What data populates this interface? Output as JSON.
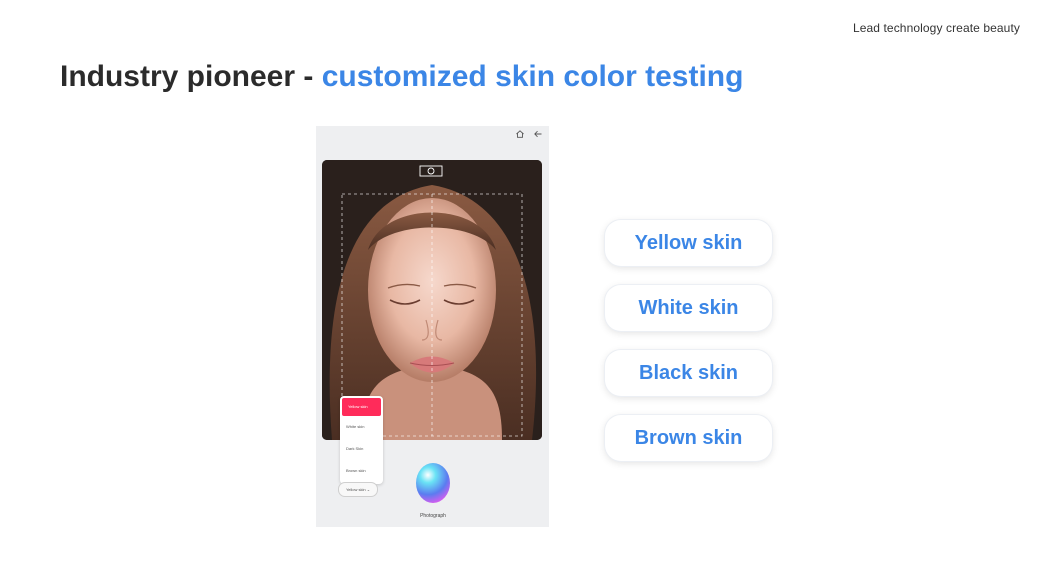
{
  "header": {
    "tagline": "Lead technology create beauty",
    "title_prefix": "Industry pioneer - ",
    "title_accent": "customized skin color testing"
  },
  "device": {
    "icons": [
      "home-icon",
      "back-arrow-icon"
    ],
    "skin_menu": [
      "Yellow skin",
      "White skin",
      "Dark Skin",
      "Brown skin"
    ],
    "selected_skin": "Yellow skin",
    "capture_label": "Photograph"
  },
  "options": [
    {
      "label": "Yellow skin"
    },
    {
      "label": "White skin"
    },
    {
      "label": "Black skin"
    },
    {
      "label": "Brown skin"
    }
  ],
  "colors": {
    "accent": "#3b86e6",
    "menu_active": "#ff2b5a",
    "title": "#2b2b2b"
  }
}
